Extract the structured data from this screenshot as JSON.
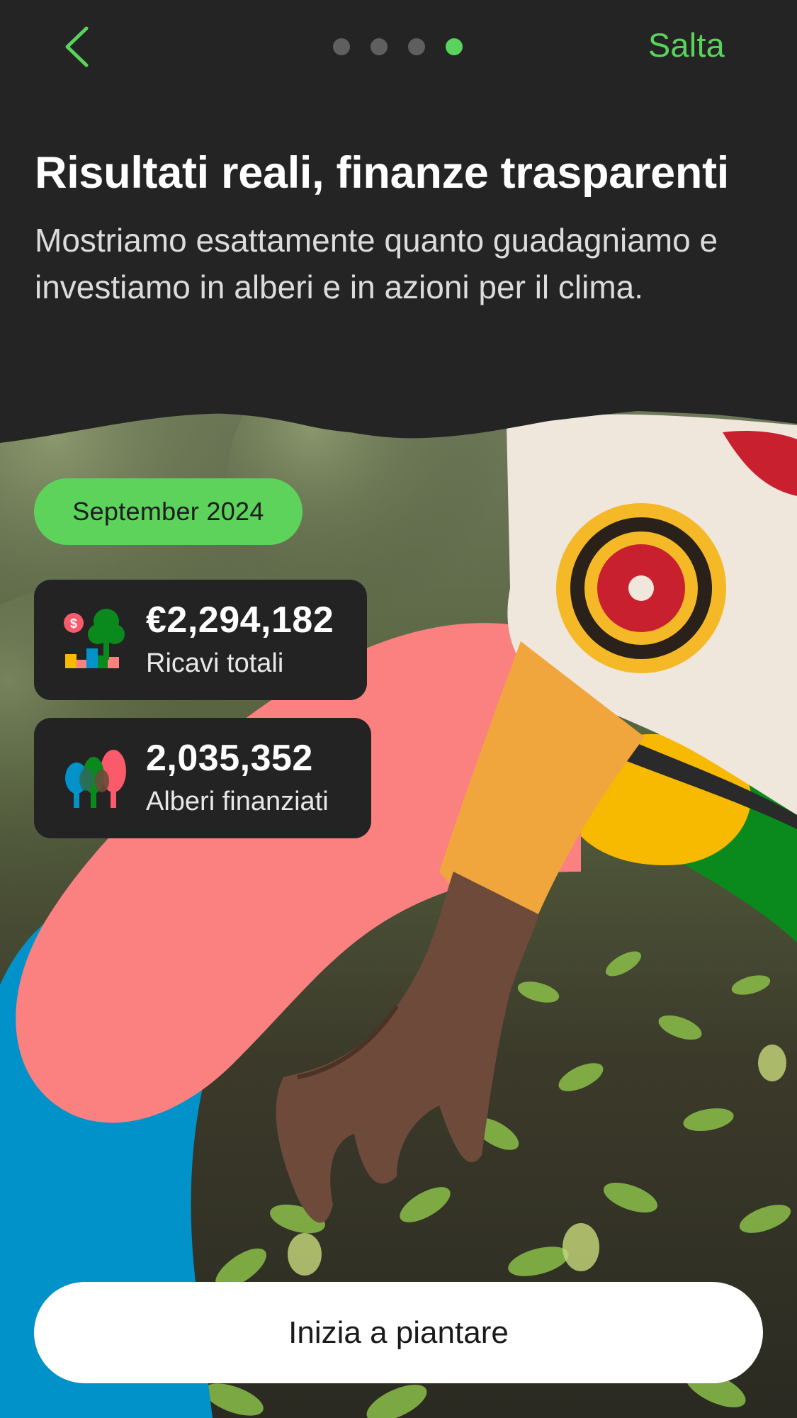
{
  "nav": {
    "back_icon": "chevron-left-icon",
    "page_count": 4,
    "active_page": 4,
    "skip_label": "Salta"
  },
  "content": {
    "title": "Risultati reali, finanze trasparenti",
    "subtitle": "Mostriamo esattamente quanto guadagniamo e investiamo in alberi e in azioni per il clima."
  },
  "stats": {
    "period": "September 2024",
    "revenue": {
      "value": "€2,294,182",
      "label": "Ricavi totali",
      "icon": "revenue-chart-icon"
    },
    "trees": {
      "value": "2,035,352",
      "label": "Alberi finanziati",
      "icon": "trees-icon"
    }
  },
  "cta": {
    "label": "Inizia a piantare"
  },
  "colors": {
    "background": "#242424",
    "accent_green": "#59d35b",
    "coral": "#fb8181",
    "blue": "#0092c8",
    "yellow": "#f7ba00",
    "dark_green": "#0a8a1c"
  }
}
